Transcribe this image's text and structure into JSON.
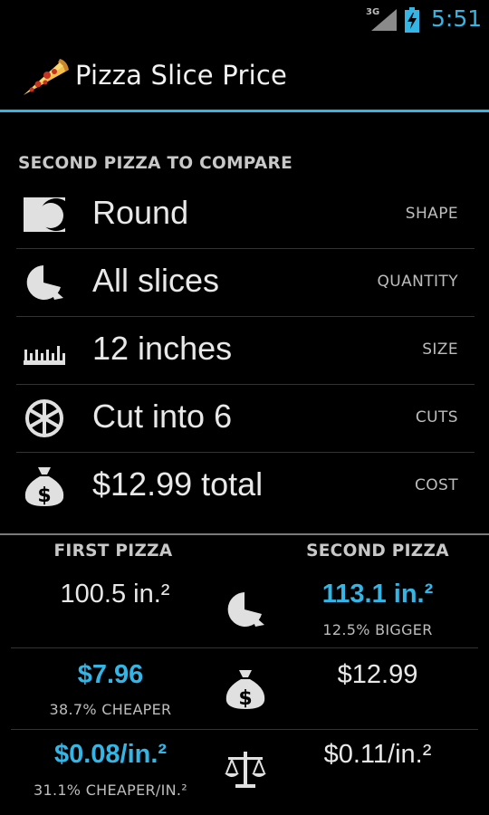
{
  "status_bar": {
    "network": "3G",
    "time": "5:51",
    "accent_color": "#33b5e5"
  },
  "action_bar": {
    "title": "Pizza Slice Price",
    "icon": "pizza-slice-icon"
  },
  "section": {
    "header": "SECOND PIZZA TO COMPARE"
  },
  "options": [
    {
      "icon": "shape-icon",
      "value": "Round",
      "label": "SHAPE"
    },
    {
      "icon": "quantity-pie-icon",
      "value": "All slices",
      "label": "QUANTITY"
    },
    {
      "icon": "ruler-icon",
      "value": "12 inches",
      "label": "SIZE"
    },
    {
      "icon": "cuts-wheel-icon",
      "value": "Cut into 6",
      "label": "CUTS"
    },
    {
      "icon": "money-bag-icon",
      "value": "$12.99 total",
      "label": "COST"
    }
  ],
  "comparison": {
    "first_header": "FIRST PIZZA",
    "second_header": "SECOND PIZZA",
    "rows": [
      {
        "icon": "quantity-pie-icon",
        "first": "100.5 in.²",
        "first_note": "",
        "second": "113.1 in.²",
        "second_note": "12.5% BIGGER"
      },
      {
        "icon": "money-bag-icon",
        "first": "$7.96",
        "first_note": "38.7% CHEAPER",
        "second": "$12.99",
        "second_note": ""
      },
      {
        "icon": "scale-icon",
        "first": "$0.08/in.²",
        "first_note": "31.1% CHEAPER/IN.²",
        "second": "$0.11/in.²",
        "second_note": ""
      }
    ]
  }
}
